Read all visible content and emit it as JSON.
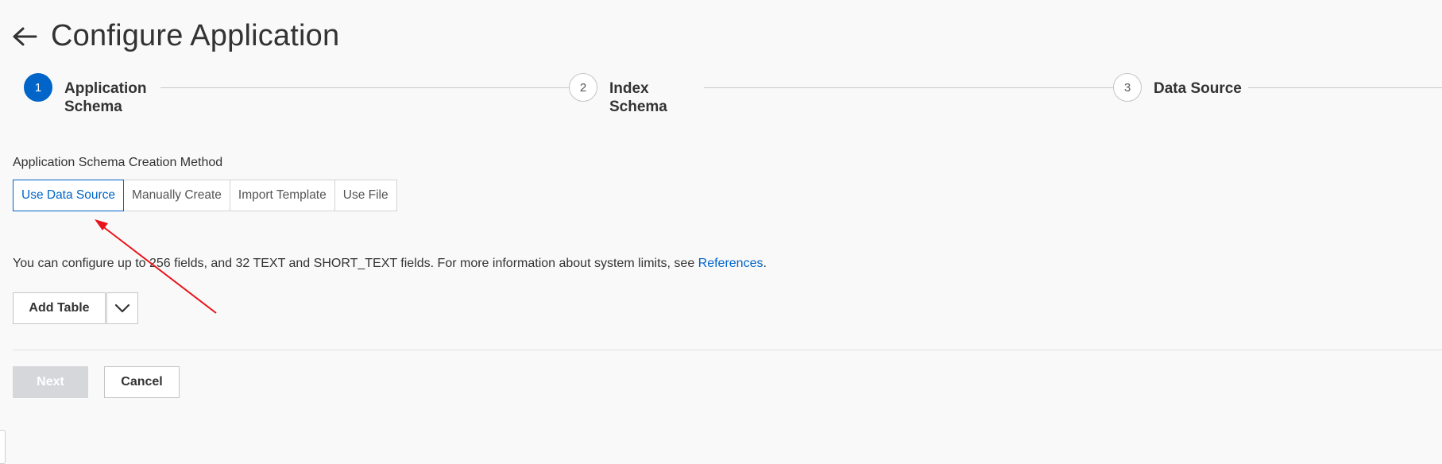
{
  "header": {
    "title": "Configure Application",
    "back_icon": "arrow-left-icon"
  },
  "steps": [
    {
      "number": "1",
      "label": "Application Schema",
      "active": true
    },
    {
      "number": "2",
      "label": "Index Schema",
      "active": false
    },
    {
      "number": "3",
      "label": "Data Source",
      "active": false
    }
  ],
  "method": {
    "label": "Application Schema Creation Method",
    "options": [
      "Use Data Source",
      "Manually Create",
      "Import Template",
      "Use File"
    ],
    "selected": "Use Data Source"
  },
  "info": {
    "text": "You can configure up to 256 fields, and 32 TEXT and SHORT_TEXT fields. For more information about system limits, see ",
    "link": "References",
    "suffix": "."
  },
  "add_table": {
    "label": "Add Table",
    "dropdown_icon": "chevron-down-icon"
  },
  "footer": {
    "next_label": "Next",
    "cancel_label": "Cancel"
  },
  "colors": {
    "accent": "#0064c8",
    "annotation_arrow": "#e8141b",
    "disabled_button": "#d5d7db"
  }
}
